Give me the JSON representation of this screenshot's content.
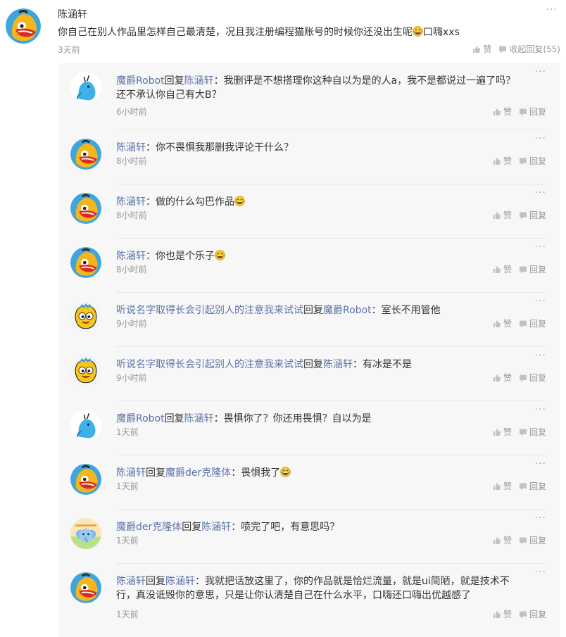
{
  "main_comment": {
    "author": "陈涵轩",
    "text": "你自己在别人作品里怎样自己最清楚，况且我注册编程猫账号的时候你还没出生呢",
    "text_suffix": "口嗨xxs",
    "time": "3天前",
    "like_label": "赞",
    "collapse_label": "收起回复(55)",
    "more_label": "···"
  },
  "replies": [
    {
      "avatar": "robot-avatar",
      "segments": [
        {
          "t": "魔爵Robot",
          "n": true
        },
        {
          "t": "回复",
          "n": false
        },
        {
          "t": "陈涵轩",
          "n": true
        },
        {
          "t": "：我删评是不想搭理你这种自以为是的人a，我不是都说过一遍了吗？还不承认你自己有大B？",
          "n": false
        }
      ],
      "emoji": false,
      "time": "6小时前"
    },
    {
      "avatar": "chen-avatar",
      "segments": [
        {
          "t": "陈涵轩",
          "n": true
        },
        {
          "t": "：你不畏惧我那删我评论干什么？",
          "n": false
        }
      ],
      "emoji": false,
      "time": "8小时前"
    },
    {
      "avatar": "chen-avatar",
      "segments": [
        {
          "t": "陈涵轩",
          "n": true
        },
        {
          "t": "：做的什么勾巴作品",
          "n": false
        }
      ],
      "emoji": true,
      "time": "8小时前"
    },
    {
      "avatar": "chen-avatar",
      "segments": [
        {
          "t": "陈涵轩",
          "n": true
        },
        {
          "t": "：你也是个乐子",
          "n": false
        }
      ],
      "emoji": true,
      "time": "8小时前"
    },
    {
      "avatar": "yellow-avatar",
      "segments": [
        {
          "t": "听说名字取得长会引起别人的注意我来试试",
          "n": true
        },
        {
          "t": "回复",
          "n": false
        },
        {
          "t": "魔爵Robot",
          "n": true
        },
        {
          "t": "：室长不用管他",
          "n": false
        }
      ],
      "emoji": false,
      "time": "9小时前"
    },
    {
      "avatar": "yellow-avatar",
      "segments": [
        {
          "t": "听说名字取得长会引起别人的注意我来试试",
          "n": true
        },
        {
          "t": "回复",
          "n": false
        },
        {
          "t": "陈涵轩",
          "n": true
        },
        {
          "t": "：有冰是不是",
          "n": false
        }
      ],
      "emoji": false,
      "time": "9小时前"
    },
    {
      "avatar": "robot-avatar",
      "segments": [
        {
          "t": "魔爵Robot",
          "n": true
        },
        {
          "t": "回复",
          "n": false
        },
        {
          "t": "陈涵轩",
          "n": true
        },
        {
          "t": "：畏惧你了？你还用畏惧？自以为是",
          "n": false
        }
      ],
      "emoji": false,
      "time": "1天前"
    },
    {
      "avatar": "chen-avatar",
      "segments": [
        {
          "t": "陈涵轩",
          "n": true
        },
        {
          "t": "回复",
          "n": false
        },
        {
          "t": "魔爵der克隆体",
          "n": true
        },
        {
          "t": "：畏惧我了",
          "n": false
        }
      ],
      "emoji": true,
      "time": "1天前"
    },
    {
      "avatar": "elephant-avatar",
      "segments": [
        {
          "t": "魔爵der克隆体",
          "n": true
        },
        {
          "t": "回复",
          "n": false
        },
        {
          "t": "陈涵轩",
          "n": true
        },
        {
          "t": "：喷完了吧，有意思吗？",
          "n": false
        }
      ],
      "emoji": false,
      "time": "1天前"
    },
    {
      "avatar": "chen-avatar",
      "segments": [
        {
          "t": "陈涵轩",
          "n": true
        },
        {
          "t": "回复",
          "n": false
        },
        {
          "t": "陈涵轩",
          "n": true
        },
        {
          "t": "：我就把话放这里了，你的作品就是恰烂流量，就是ui简陋，就是技术不行，真没诋毁你的意思，只是让你认清楚自己在什么水平，口嗨还口嗨出优越感了",
          "n": false
        }
      ],
      "emoji": false,
      "time": "1天前"
    }
  ],
  "reply_like_label": "赞",
  "reply_reply_label": "回复",
  "more_label": "···",
  "colors": {
    "name_link": "#5b73a8",
    "meta_gray": "#999999",
    "reply_bg": "#f7f7f7"
  }
}
